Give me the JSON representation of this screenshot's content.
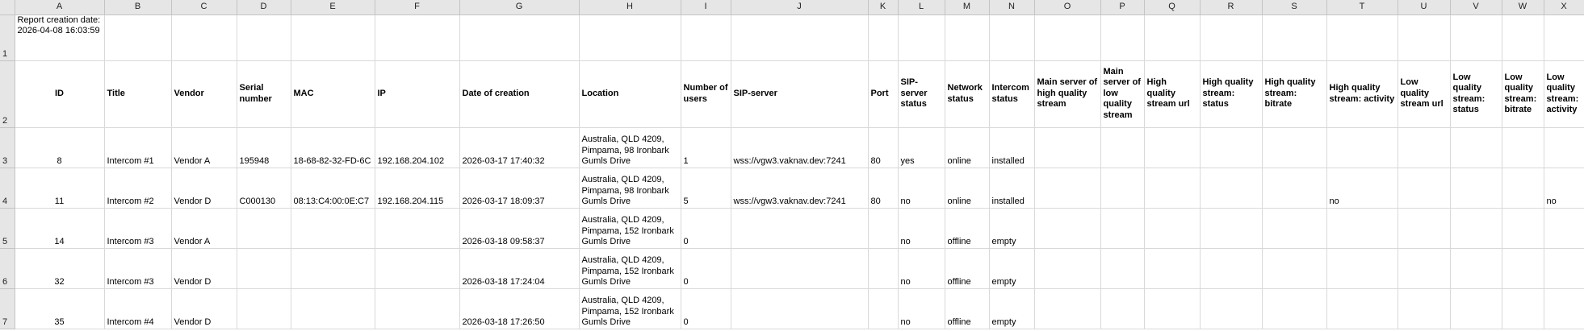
{
  "columns": [
    "A",
    "B",
    "C",
    "D",
    "E",
    "F",
    "G",
    "H",
    "I",
    "J",
    "K",
    "L",
    "M",
    "N",
    "O",
    "P",
    "Q",
    "R",
    "S",
    "T",
    "U",
    "V",
    "W",
    "X"
  ],
  "report_info": "Report creation date: 2026-04-08 16:03:59",
  "headers": [
    "ID",
    "Title",
    "Vendor",
    "Serial number",
    "MAC",
    "IP",
    "Date of creation",
    "Location",
    "Number of users",
    "SIP-server",
    "Port",
    "SIP-server status",
    "Network status",
    "Intercom status",
    "Main server of high quality stream",
    "Main server of low quality stream",
    "High quality stream url",
    "High quality stream: status",
    "High quality stream: bitrate",
    "High quality stream: activity",
    "Low quality stream url",
    "Low quality stream: status",
    "Low quality stream: bitrate",
    "Low quality stream: activity"
  ],
  "row_numbers": [
    "1",
    "2",
    "3",
    "4",
    "5",
    "6",
    "7"
  ],
  "rows": [
    [
      "8",
      "Intercom #1",
      "Vendor A",
      "195948",
      "18-68-82-32-FD-6C",
      "192.168.204.102",
      "2026-03-17 17:40:32",
      "Australia, QLD 4209, Pimpama, 98 Ironbark Gumls Drive",
      "1",
      "wss://vgw3.vaknav.dev:7241",
      "80",
      "yes",
      "online",
      "installed",
      "",
      "",
      "",
      "",
      "",
      "",
      "",
      "",
      "",
      ""
    ],
    [
      "11",
      "Intercom #2",
      "Vendor D",
      "C000130",
      "08:13:C4:00:0E:C7",
      "192.168.204.115",
      "2026-03-17 18:09:37",
      "Australia, QLD 4209, Pimpama, 98 Ironbark Gumls Drive",
      "5",
      "wss://vgw3.vaknav.dev:7241",
      "80",
      "no",
      "online",
      "installed",
      "",
      "",
      "",
      "",
      "",
      "no",
      "",
      "",
      "",
      "no"
    ],
    [
      "14",
      "Intercom #3",
      "Vendor A",
      "",
      "",
      "",
      "2026-03-18 09:58:37",
      "Australia, QLD 4209, Pimpama, 152 Ironbark Gumls Drive",
      "0",
      "",
      "",
      "no",
      "offline",
      "empty",
      "",
      "",
      "",
      "",
      "",
      "",
      "",
      "",
      "",
      ""
    ],
    [
      "32",
      "Intercom #3",
      "Vendor D",
      "",
      "",
      "",
      "2026-03-18 17:24:04",
      "Australia, QLD 4209, Pimpama, 152 Ironbark Gumls Drive",
      "0",
      "",
      "",
      "no",
      "offline",
      "empty",
      "",
      "",
      "",
      "",
      "",
      "",
      "",
      "",
      "",
      ""
    ],
    [
      "35",
      "Intercom #4",
      "Vendor D",
      "",
      "",
      "",
      "2026-03-18 17:26:50",
      "Australia, QLD 4209, Pimpama, 152 Ironbark Gumls Drive",
      "0",
      "",
      "",
      "no",
      "offline",
      "empty",
      "",
      "",
      "",
      "",
      "",
      "",
      "",
      "",
      "",
      ""
    ]
  ]
}
